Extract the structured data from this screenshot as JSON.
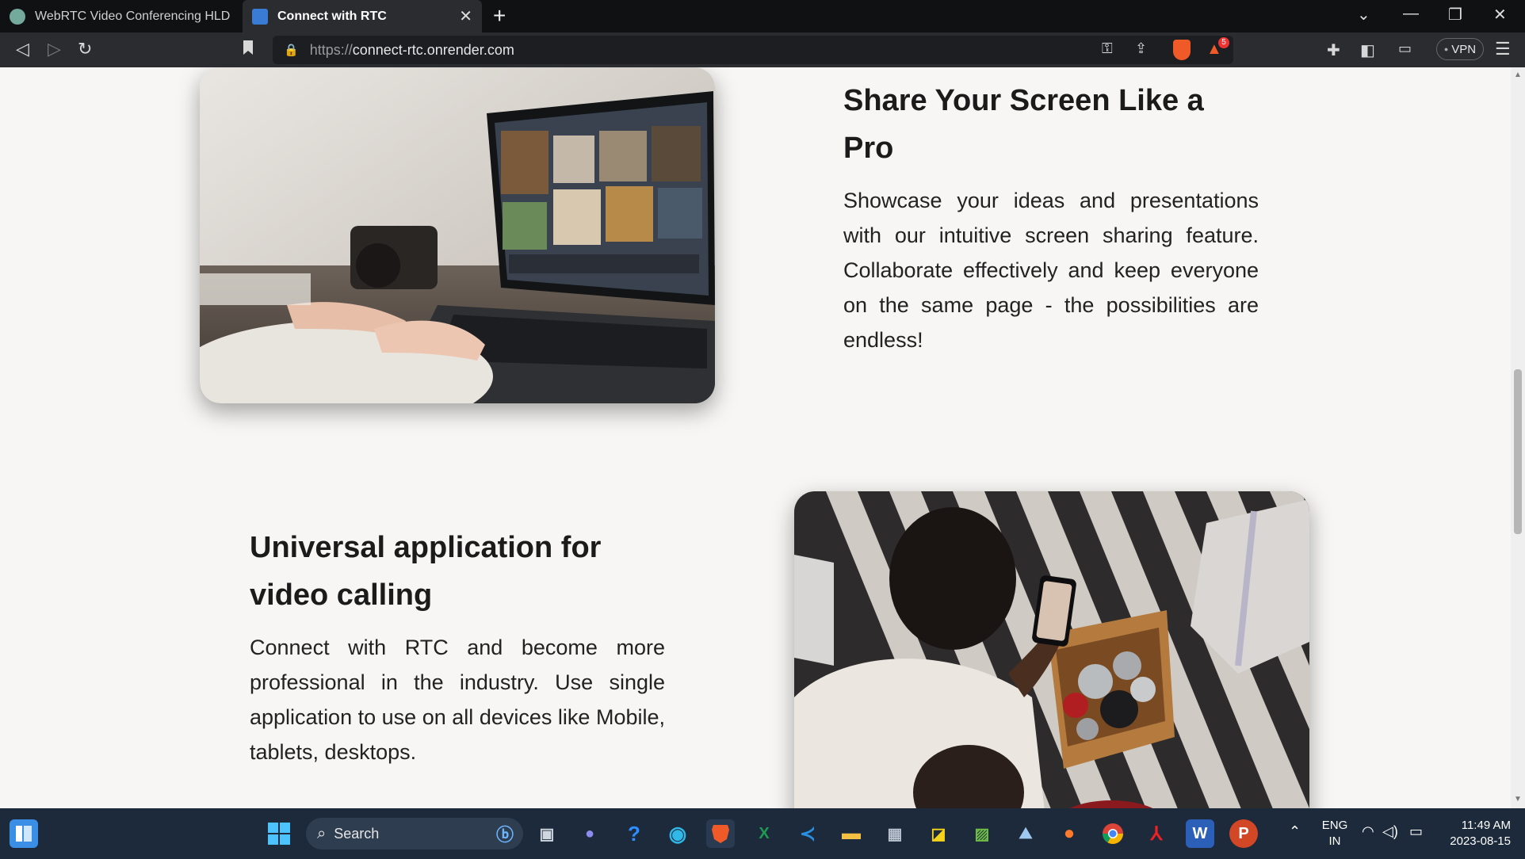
{
  "browser": {
    "tabs": [
      {
        "label": "WebRTC Video Conferencing HLD",
        "active": false
      },
      {
        "label": "Connect with RTC",
        "active": true
      }
    ],
    "url_protocol": "https://",
    "url_host": "connect-rtc.onrender.com",
    "vpn_label": "VPN",
    "notification_count": "5"
  },
  "page": {
    "features": [
      {
        "title": "Share Your Screen Like a Pro",
        "body": "Showcase your ideas and presentations with our intuitive screen sharing feature. Collaborate effectively and keep everyone on the same page - the possibilities are endless!"
      },
      {
        "title": "Universal application for video calling",
        "body": "Connect with RTC and become more professional in the industry. Use single application to use on all devices like Mobile, tablets, desktops."
      }
    ]
  },
  "taskbar": {
    "search_label": "Search",
    "language": "ENG",
    "region": "IN",
    "time": "11:49 AM",
    "date": "2023-08-15"
  },
  "colors": {
    "page_bg": "#f7f6f4",
    "brave_orange": "#f05a28",
    "taskbar_bg": "#1c2a3c"
  }
}
